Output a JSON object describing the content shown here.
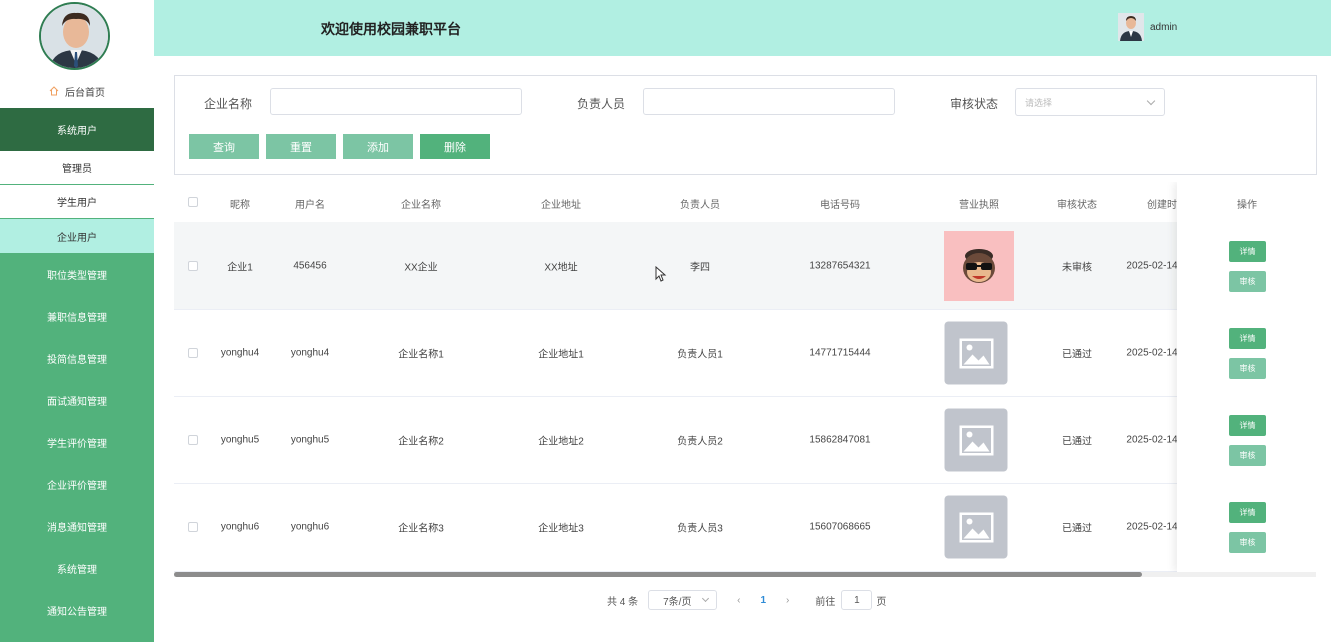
{
  "header": {
    "title": "欢迎使用校园兼职平台",
    "username": "admin"
  },
  "sidebar": {
    "home_label": "后台首页",
    "system_users": "系统用户",
    "sub_items": [
      "管理员",
      "学生用户",
      "企业用户"
    ],
    "active_sub_index": 2,
    "menu_items": [
      "职位类型管理",
      "兼职信息管理",
      "投简信息管理",
      "面试通知管理",
      "学生评价管理",
      "企业评价管理",
      "消息通知管理",
      "系统管理",
      "通知公告管理"
    ]
  },
  "search": {
    "company_name_label": "企业名称",
    "company_name_value": "",
    "contact_label": "负责人员",
    "contact_value": "",
    "status_label": "审核状态",
    "status_placeholder": "请选择",
    "buttons": [
      "查询",
      "重置",
      "添加",
      "删除"
    ]
  },
  "table": {
    "columns": [
      "昵称",
      "用户名",
      "企业名称",
      "企业地址",
      "负责人员",
      "电话号码",
      "营业执照",
      "审核状态",
      "创建时",
      "操作"
    ],
    "rows": [
      {
        "nickname": "企业1",
        "username": "456456",
        "company": "XX企业",
        "address": "XX地址",
        "contact": "李四",
        "phone": "13287654321",
        "license": "custom",
        "status": "未审核",
        "created": "2025-02-14"
      },
      {
        "nickname": "yonghu4",
        "username": "yonghu4",
        "company": "企业名称1",
        "address": "企业地址1",
        "contact": "负责人员1",
        "phone": "14771715444",
        "license": "placeholder",
        "status": "已通过",
        "created": "2025-02-14"
      },
      {
        "nickname": "yonghu5",
        "username": "yonghu5",
        "company": "企业名称2",
        "address": "企业地址2",
        "contact": "负责人员2",
        "phone": "15862847081",
        "license": "placeholder",
        "status": "已通过",
        "created": "2025-02-14"
      },
      {
        "nickname": "yonghu6",
        "username": "yonghu6",
        "company": "企业名称3",
        "address": "企业地址3",
        "contact": "负责人员3",
        "phone": "15607068665",
        "license": "placeholder",
        "status": "已通过",
        "created": "2025-02-14"
      }
    ],
    "op_detail": "详情",
    "op_review": "审核"
  },
  "pagination": {
    "total": "共 4 条",
    "page_size": "7条/页",
    "current_page": "1",
    "goto_label": "前往",
    "goto_value": "1",
    "page_unit": "页"
  },
  "colors": {
    "sidebar": "#52b27c",
    "sidebar_dark": "#2e6b42",
    "header": "#b1efe2",
    "button_primary": "#52b27c",
    "button_light": "#7cc5a4"
  }
}
